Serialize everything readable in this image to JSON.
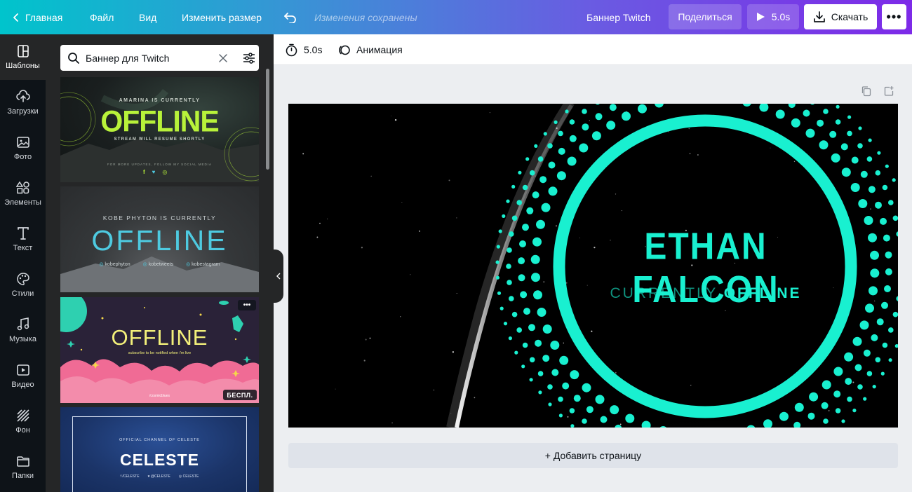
{
  "topbar": {
    "home_label": "Главная",
    "file_label": "Файл",
    "view_label": "Вид",
    "resize_label": "Изменить размер",
    "saved_status": "Изменения сохранены",
    "doc_title": "Баннер  Twitch",
    "share_label": "Поделиться",
    "play_label": "5.0s",
    "download_label": "Скачать",
    "more_label": "•••"
  },
  "sidebar": {
    "items": [
      {
        "label": "Шаблоны",
        "icon": "templates-icon"
      },
      {
        "label": "Загрузки",
        "icon": "upload-icon"
      },
      {
        "label": "Фото",
        "icon": "photo-icon"
      },
      {
        "label": "Элементы",
        "icon": "elements-icon"
      },
      {
        "label": "Текст",
        "icon": "text-icon"
      },
      {
        "label": "Стили",
        "icon": "palette-icon"
      },
      {
        "label": "Музыка",
        "icon": "music-icon"
      },
      {
        "label": "Видео",
        "icon": "video-icon"
      },
      {
        "label": "Фон",
        "icon": "background-icon"
      },
      {
        "label": "Папки",
        "icon": "folder-icon"
      }
    ]
  },
  "search": {
    "value": "Баннер для Twitch"
  },
  "templates": [
    {
      "line1": "AMARINA IS CURRENTLY",
      "headline": "OFFLINE",
      "line3": "STREAM WILL RESUME SHORTLY",
      "line4": "FOR MORE UPDATES, FOLLOW MY SOCIAL MEDIA",
      "accent": "#b8f23a"
    },
    {
      "line1": "KOBE PHYTON IS CURRENTLY",
      "headline": "OFFLINE",
      "handles": [
        "kobephyton",
        "kobetweets",
        "kobestagram"
      ],
      "accent": "#4ecae0"
    },
    {
      "headline": "OFFLINE",
      "line3": "subscribe to be notified when i'm live",
      "handle": "/cosmicblues",
      "badge": "БЕСПЛ.",
      "more_label": "•••",
      "accent": "#f3f07a"
    },
    {
      "line1": "OFFICIAL CHANNEL OF CELESTE",
      "headline": "CELESTE",
      "handles": [
        "/CELESTE",
        "@CELESTE",
        "CELESTE"
      ]
    }
  ],
  "toolbar": {
    "duration_label": "5.0s",
    "animation_label": "Анимация"
  },
  "canvas": {
    "title": "ETHAN FALCON",
    "subtitle_thin": "CURRENTLY",
    "subtitle_bold": "OFFLINE",
    "accent": "#19f0d0"
  },
  "add_page_label": "+ Добавить страницу"
}
